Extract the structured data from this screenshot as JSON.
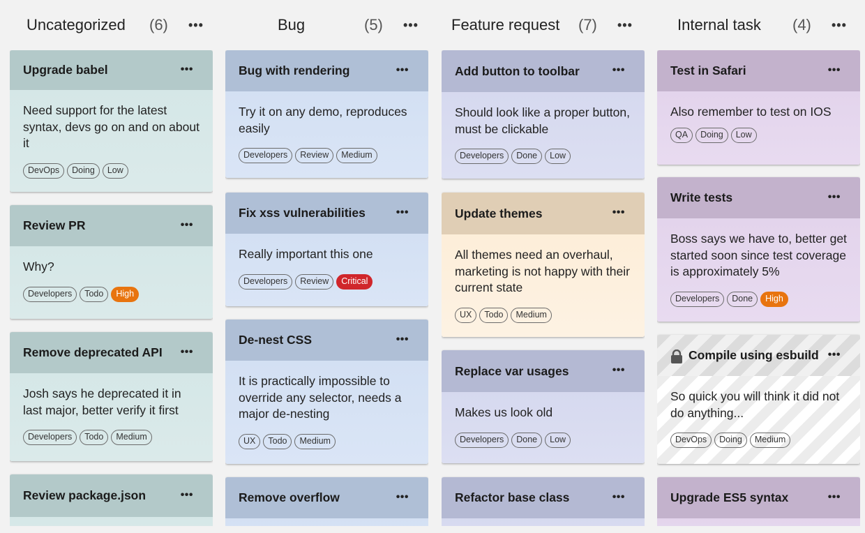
{
  "columns": [
    {
      "title": "Uncategorized",
      "count": "(6)",
      "cards": [
        {
          "title": "Upgrade babel",
          "body": "Need support for the latest syntax, devs go on and on about it",
          "tags": [
            "DevOps",
            "Doing",
            "Low"
          ]
        },
        {
          "title": "Review PR",
          "body": "Why?",
          "tags": [
            "Developers",
            "Todo",
            "High"
          ]
        },
        {
          "title": "Remove deprecated API",
          "body": "Josh says he deprecated it in last major, better verify it first",
          "tags": [
            "Developers",
            "Todo",
            "Medium"
          ]
        },
        {
          "title": "Review package.json",
          "body": "",
          "tags": []
        }
      ]
    },
    {
      "title": "Bug",
      "count": "(5)",
      "cards": [
        {
          "title": "Bug with rendering",
          "body": "Try it on any demo, reproduces easily",
          "tags": [
            "Developers",
            "Review",
            "Medium"
          ]
        },
        {
          "title": "Fix xss vulnerabilities",
          "body": "Really important this one",
          "tags": [
            "Developers",
            "Review",
            "Critical"
          ]
        },
        {
          "title": "De-nest CSS",
          "body": "It is practically impossible to override any selector, needs a major de-nesting",
          "tags": [
            "UX",
            "Todo",
            "Medium"
          ]
        },
        {
          "title": "Remove overflow",
          "body": "",
          "tags": []
        }
      ]
    },
    {
      "title": "Feature request",
      "count": "(7)",
      "cards": [
        {
          "title": "Add button to toolbar",
          "body": "Should look like a proper button, must be clickable",
          "tags": [
            "Developers",
            "Done",
            "Low"
          ]
        },
        {
          "title": "Update themes",
          "body": "All themes need an overhaul, marketing is not happy with their current state",
          "tags": [
            "UX",
            "Todo",
            "Medium"
          ]
        },
        {
          "title": "Replace var usages",
          "body": "Makes us look old",
          "tags": [
            "Developers",
            "Done",
            "Low"
          ]
        },
        {
          "title": "Refactor base class",
          "body": "",
          "tags": []
        }
      ]
    },
    {
      "title": "Internal task",
      "count": "(4)",
      "cards": [
        {
          "title": "Test in Safari",
          "body": "Also remember to test on IOS",
          "tags": [
            "QA",
            "Doing",
            "Low"
          ]
        },
        {
          "title": "Write tests",
          "body": "Boss says we have to, better get started soon since test coverage is approximately 5%",
          "tags": [
            "Developers",
            "Done",
            "High"
          ]
        },
        {
          "title": "Compile using esbuild",
          "body": "So quick you will think it did not do anything...",
          "tags": [
            "DevOps",
            "Doing",
            "Medium"
          ]
        },
        {
          "title": "Upgrade ES5 syntax",
          "body": "",
          "tags": []
        }
      ]
    }
  ],
  "menu_glyph": "•••",
  "colors": {
    "high": "#e8740f",
    "critical": "#d0262b"
  }
}
